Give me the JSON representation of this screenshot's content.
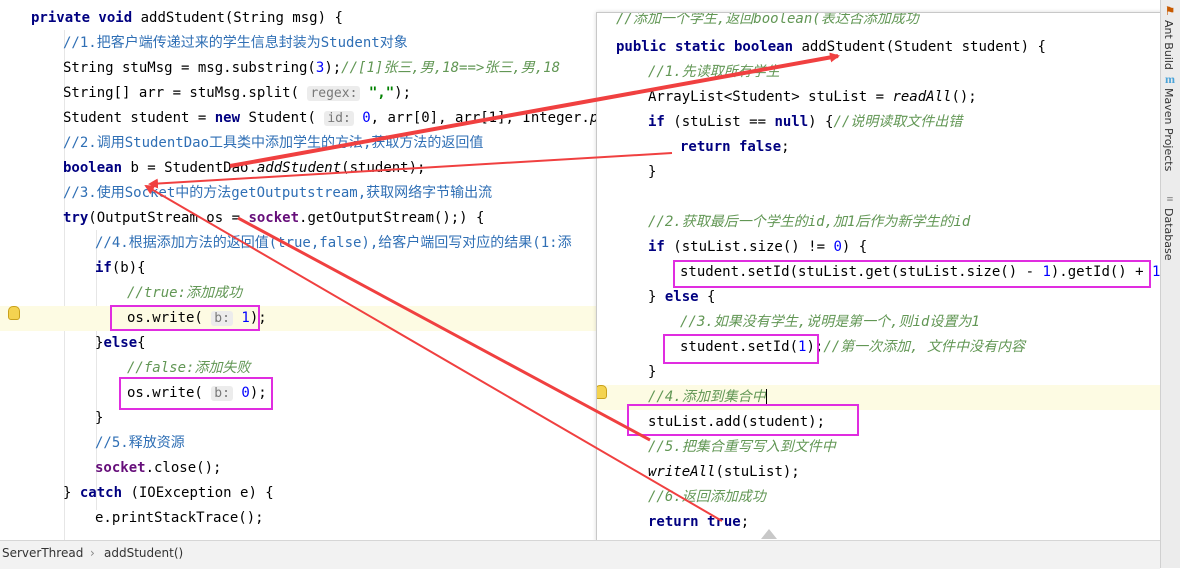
{
  "editor": {
    "l1": {
      "kw": "private void",
      "rest": " addStudent(String msg) {"
    },
    "l2": "//1.把客户端传递过来的学生信息封装为Student对象",
    "l3": {
      "a": "String stuMsg = msg.substring(",
      "n": "3",
      "b": ");",
      "c": "//[1]张三,男,18==>张三,男,18"
    },
    "l4": {
      "a": "String[] arr = stuMsg.split( ",
      "hint": "regex:",
      "s": "\",\"",
      "b": ");"
    },
    "l5": {
      "a": "Student student = ",
      "kw": "new",
      "b": " Student( ",
      "hint": "id:",
      "n": "0",
      "c": ", arr[0], arr[1], Integer.",
      "d": "parse"
    },
    "l6": "//2.调用StudentDao工具类中添加学生的方法,获取方法的返回值",
    "l7": {
      "kw": "boolean",
      "a": " b = StudentDao.",
      "m": "addStudent",
      "b": "(student);"
    },
    "l8": "//3.使用Socket中的方法getOutputstream,获取网络字节输出流",
    "l9": {
      "kw": "try",
      "a": "(OutputStream os = ",
      "f": "socket",
      "b": ".getOutputStream();) {"
    },
    "l10": "//4.根据添加方法的返回值(true,false),给客户端回写对应的结果(1:添",
    "l11": {
      "kw": "if",
      "a": "(b){"
    },
    "l12": "//true:添加成功",
    "l13": {
      "a": "os.write( ",
      "hint": "b:",
      "n": "1",
      "b": ");"
    },
    "l14": {
      "a": "}",
      "kw": "else",
      "b": "{"
    },
    "l15": "//false:添加失败",
    "l16": {
      "a": "os.write( ",
      "hint": "b:",
      "n": "0",
      "b": ");"
    },
    "l17": "}",
    "l18": "//5.释放资源",
    "l19": {
      "f": "socket",
      "a": ".close();"
    },
    "l20": {
      "a": "} ",
      "kw": "catch",
      "b": " (IOException e) {"
    },
    "l21": "e.printStackTrace();"
  },
  "popup": {
    "p0": "//添加一个学生,返回boolean(表达否添加成功",
    "p1": {
      "kw": "public static boolean",
      "a": " addStudent(Student student) {"
    },
    "p2": "//1.先读取所有学生",
    "p3": {
      "a": "ArrayList<Student> stuList = ",
      "m": "readAll",
      "b": "();"
    },
    "p4": {
      "kw": "if",
      "a": " (stuList == ",
      "kw2": "null",
      "b": ") {",
      "c": "//说明读取文件出错"
    },
    "p5": {
      "kw": "return false",
      "b": ";"
    },
    "p6": "}",
    "p7": "//2.获取最后一个学生的id,加1后作为新学生的id",
    "p8": {
      "kw": "if",
      "a": " (stuList.size() != ",
      "n": "0",
      "b": ") {"
    },
    "p9": {
      "a": "student.setId(stuList.get(stuList.size() - ",
      "n": "1",
      "b": ").getId() + ",
      "n2": "1",
      "c": ")",
      "d": ";/"
    },
    "p10": {
      "a": "} ",
      "kw": "else",
      "b": " {"
    },
    "p11": "//3.如果没有学生,说明是第一个,则id设置为1",
    "p12": {
      "a": "student.setId(",
      "n": "1",
      "b": ");",
      "c": "//第一次添加, 文件中没有内容"
    },
    "p13": "}",
    "p14": "//4.添加到集合中",
    "p15": "stuList.add(student);",
    "p16": "//5.把集合重写写入到文件中",
    "p17": {
      "m": "writeAll",
      "a": "(stuList);"
    },
    "p18": "//6.返回添加成功",
    "p19": {
      "kw": "return true",
      "b": ";"
    },
    "p20": "}"
  },
  "toolstrip": {
    "ant": "Ant Build",
    "maven": "Maven Projects",
    "db": "Database"
  },
  "status": {
    "crumb1": "ServerThread",
    "sep": "›",
    "crumb2": "addStudent()"
  },
  "colors": {
    "highlight_box": "#e02de0",
    "arrow": "#f04040",
    "keyword": "#000080",
    "comment": "#629755"
  }
}
